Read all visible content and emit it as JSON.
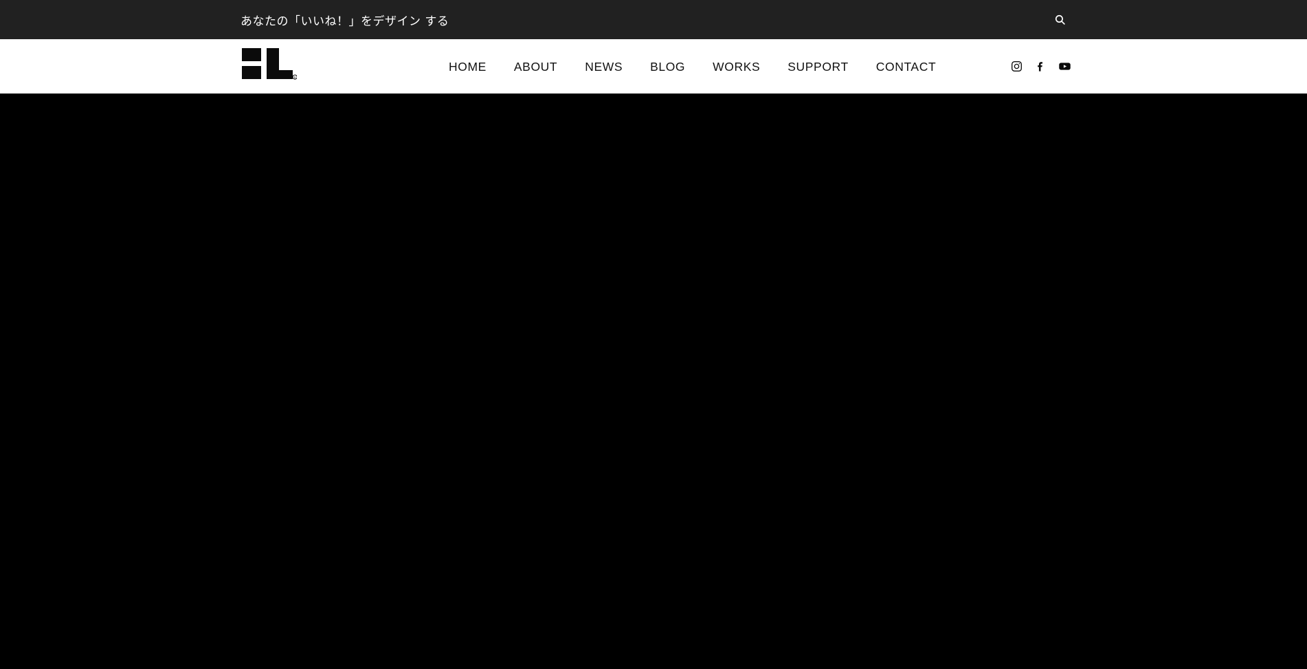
{
  "topbar": {
    "tagline": "あなたの「いいね！」をデザイン する",
    "search_icon": "search-icon",
    "background_color": "#212121",
    "text_color": "#ffffff"
  },
  "header": {
    "background_color": "#ffffff",
    "logo": {
      "name": "site-logo",
      "mark": "®",
      "color": "#0b0b0b"
    },
    "nav": {
      "items": [
        {
          "label": "HOME"
        },
        {
          "label": "ABOUT"
        },
        {
          "label": "NEWS"
        },
        {
          "label": "BLOG"
        },
        {
          "label": "WORKS"
        },
        {
          "label": "SUPPORT"
        },
        {
          "label": "CONTACT"
        }
      ]
    },
    "social": {
      "items": [
        {
          "name": "instagram-icon"
        },
        {
          "name": "facebook-icon"
        },
        {
          "name": "youtube-icon"
        }
      ]
    }
  },
  "hero": {
    "background_color": "#000000"
  }
}
